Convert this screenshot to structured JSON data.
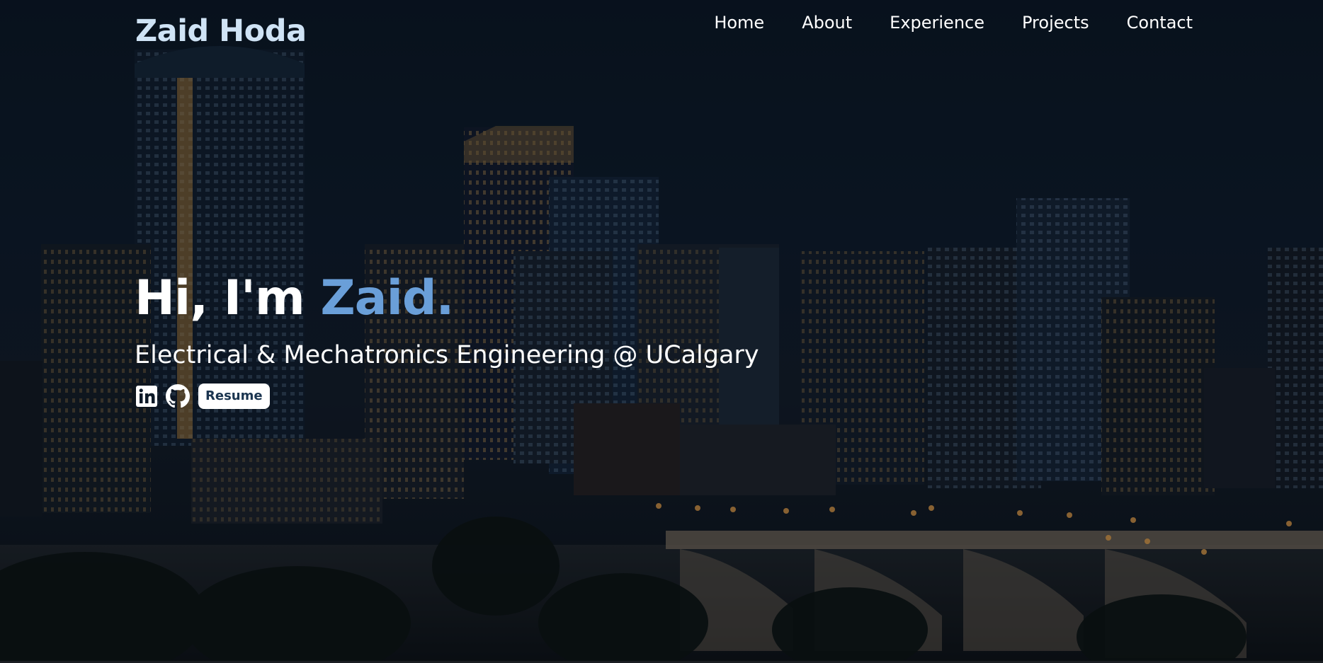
{
  "header": {
    "brand": "Zaid Hoda",
    "nav": [
      {
        "label": "Home"
      },
      {
        "label": "About"
      },
      {
        "label": "Experience"
      },
      {
        "label": "Projects"
      },
      {
        "label": "Contact"
      }
    ]
  },
  "hero": {
    "greeting_prefix": "Hi, I'm ",
    "greeting_name": "Zaid.",
    "subtitle": "Electrical & Mechatronics Engineering @ UCalgary",
    "socials": [
      {
        "icon": "linkedin-icon"
      },
      {
        "icon": "github-icon"
      }
    ],
    "resume_label": "Resume"
  },
  "colors": {
    "brand": "#cfe3f5",
    "accent": "#6a9fd9",
    "resume_text": "#1b3550",
    "background": "#0d1a28"
  }
}
